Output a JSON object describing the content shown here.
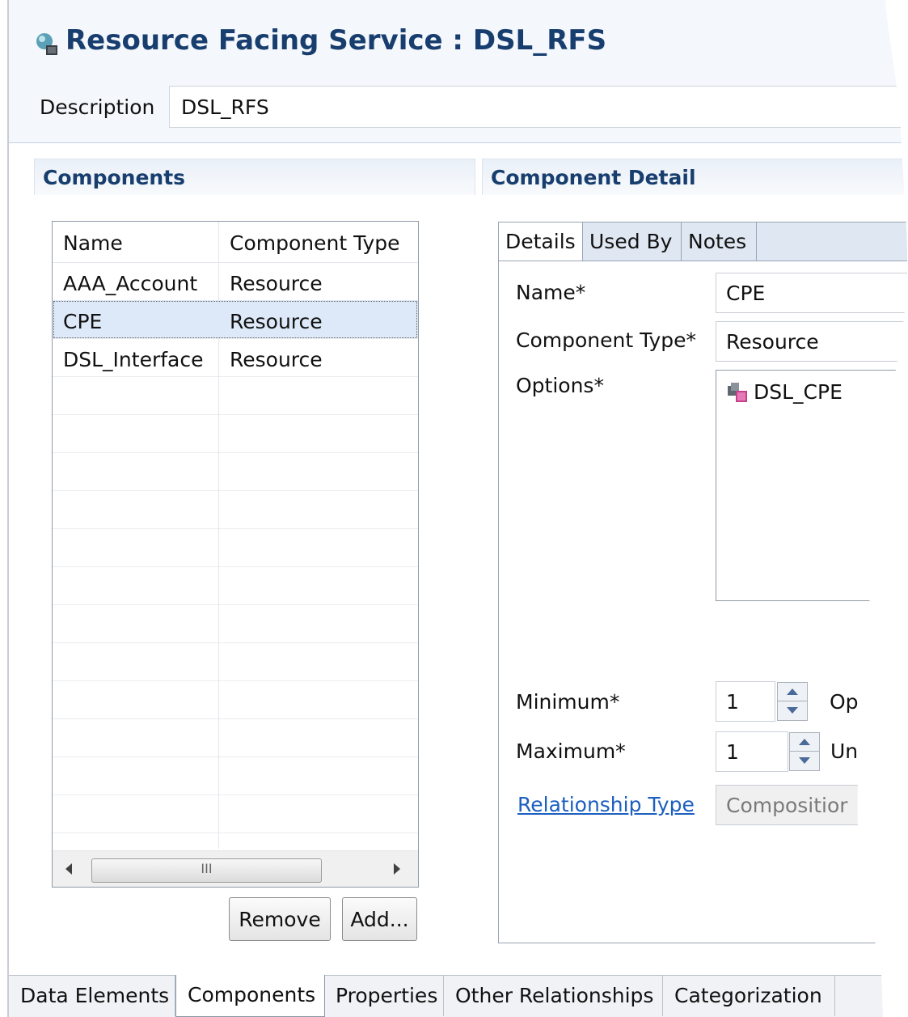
{
  "window": {
    "title": "Resource Facing Service : DSL_RFS",
    "title_icon": "service-icon"
  },
  "description": {
    "label": "Description",
    "value": "DSL_RFS"
  },
  "components_section": {
    "header": "Components",
    "table": {
      "columns": [
        "Name",
        "Component Type"
      ],
      "rows": [
        {
          "name": "AAA_Account",
          "type": "Resource",
          "selected": false
        },
        {
          "name": "CPE",
          "type": "Resource",
          "selected": true
        },
        {
          "name": "DSL_Interface",
          "type": "Resource",
          "selected": false
        }
      ],
      "scroll_grip": "III"
    },
    "buttons": {
      "remove": "Remove",
      "add": "Add..."
    }
  },
  "detail_section": {
    "header": "Component Detail",
    "tabs": [
      "Details",
      "Used By",
      "Notes"
    ],
    "active_tab": "Details",
    "fields": {
      "name_label": "Name*",
      "name_value": "CPE",
      "type_label": "Component Type*",
      "type_value": "Resource",
      "options_label": "Options*",
      "options": [
        {
          "label": "DSL_CPE",
          "icon": "resource-spec-icon"
        }
      ],
      "minimum_label": "Minimum*",
      "minimum_value": "1",
      "minimum_side": "Op",
      "maximum_label": "Maximum*",
      "maximum_value": "1",
      "maximum_side": "Un",
      "relationship_label": "Relationship Type",
      "relationship_value": "Compositior"
    }
  },
  "bottom_tabs": [
    "Data Elements",
    "Components",
    "Properties",
    "Other Relationships",
    "Categorization"
  ],
  "bottom_active": "Components",
  "colors": {
    "title": "#173e6e",
    "link": "#1c5fbf",
    "selection": "#dde9f8"
  }
}
